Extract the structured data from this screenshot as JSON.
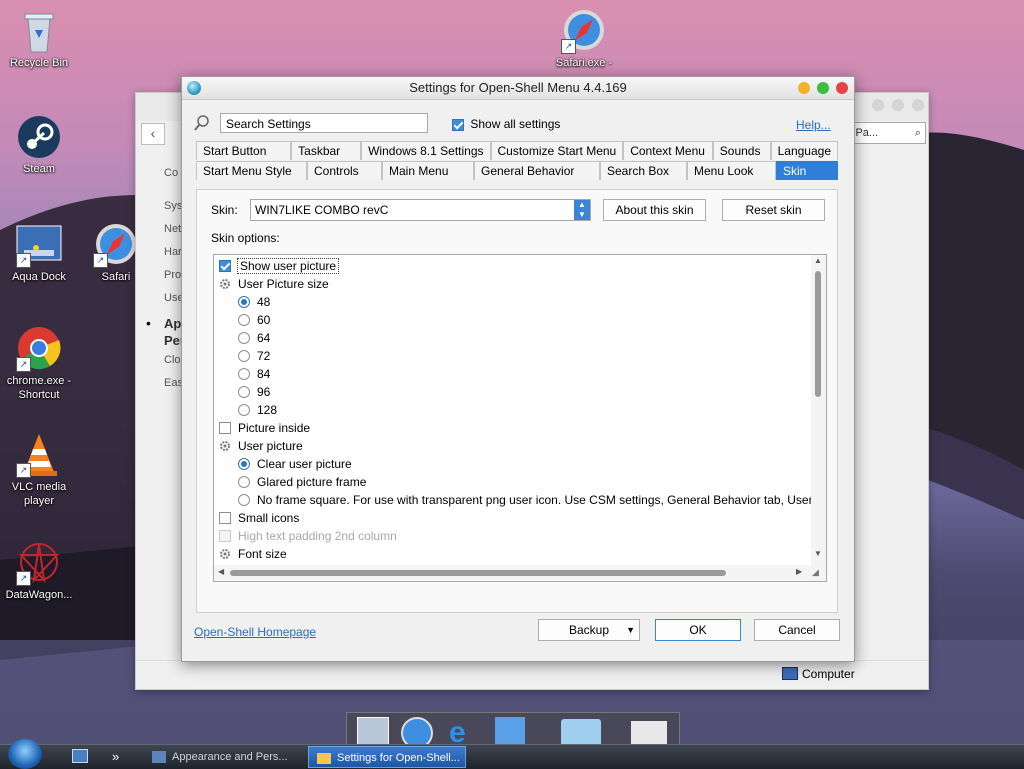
{
  "desktop": {
    "icons": [
      {
        "id": "recycle",
        "label": "Recycle Bin"
      },
      {
        "id": "steam",
        "label": "Steam"
      },
      {
        "id": "aqua",
        "label": "Aqua Dock"
      },
      {
        "id": "safari",
        "label": "Safari"
      },
      {
        "id": "chrome",
        "label": "chrome.exe - Shortcut"
      },
      {
        "id": "vlc",
        "label": "VLC media player"
      },
      {
        "id": "datawagon",
        "label": "DataWagon..."
      },
      {
        "id": "safariexe",
        "label": "Safari.exe -"
      }
    ]
  },
  "bg_window": {
    "search_text": "ntrol Pa...",
    "side_items": [
      "Co",
      "Sys",
      "Net",
      "Har",
      "Pro",
      "Use",
      "Ap",
      "Per",
      "Clo",
      "Eas"
    ],
    "status": "Computer"
  },
  "dialog": {
    "title": "Settings for Open-Shell Menu 4.4.169",
    "search_value": "Search Settings",
    "show_all_label": "Show all settings",
    "help_link": "Help...",
    "tabs_row1": [
      "Start Button",
      "Taskbar",
      "Windows 8.1 Settings",
      "Customize Start Menu",
      "Context Menu",
      "Sounds",
      "Language"
    ],
    "tabs_row2": [
      "Start Menu Style",
      "Controls",
      "Main Menu",
      "General Behavior",
      "Search Box",
      "Menu Look",
      "Skin"
    ],
    "skin_label": "Skin:",
    "skin_value": "WIN7LIKE COMBO revC",
    "about_btn": "About this skin",
    "reset_btn": "Reset skin",
    "options_label": "Skin options:",
    "options": [
      {
        "type": "check",
        "checked": true,
        "indent": 0,
        "label": "Show user picture",
        "focus": true
      },
      {
        "type": "group",
        "indent": 0,
        "label": "User Picture size"
      },
      {
        "type": "radio",
        "checked": true,
        "indent": 1,
        "label": "48"
      },
      {
        "type": "radio",
        "checked": false,
        "indent": 1,
        "label": "60"
      },
      {
        "type": "radio",
        "checked": false,
        "indent": 1,
        "label": "64"
      },
      {
        "type": "radio",
        "checked": false,
        "indent": 1,
        "label": "72"
      },
      {
        "type": "radio",
        "checked": false,
        "indent": 1,
        "label": "84"
      },
      {
        "type": "radio",
        "checked": false,
        "indent": 1,
        "label": "96"
      },
      {
        "type": "radio",
        "checked": false,
        "indent": 1,
        "label": "128"
      },
      {
        "type": "check",
        "checked": false,
        "indent": 0,
        "label": "Picture inside"
      },
      {
        "type": "group",
        "indent": 0,
        "label": "User picture"
      },
      {
        "type": "radio",
        "checked": true,
        "indent": 1,
        "label": "Clear user picture"
      },
      {
        "type": "radio",
        "checked": false,
        "indent": 1,
        "label": "Glared picture frame"
      },
      {
        "type": "radio",
        "checked": false,
        "indent": 1,
        "label": "No frame square. For use with transparent png user icon. Use CSM settings, General Behavior tab, User pi"
      },
      {
        "type": "check",
        "checked": false,
        "indent": 0,
        "label": "Small icons"
      },
      {
        "type": "check",
        "checked": false,
        "indent": 0,
        "disabled": true,
        "label": "High text padding 2nd column"
      },
      {
        "type": "group",
        "indent": 0,
        "label": "Font size"
      }
    ],
    "homepage_link": "Open-Shell Homepage",
    "backup_btn": "Backup",
    "ok_btn": "OK",
    "cancel_btn": "Cancel"
  },
  "taskbar": {
    "items": [
      "Appearance and Pers...",
      "Settings for Open-Shell..."
    ],
    "chevron": "»"
  }
}
